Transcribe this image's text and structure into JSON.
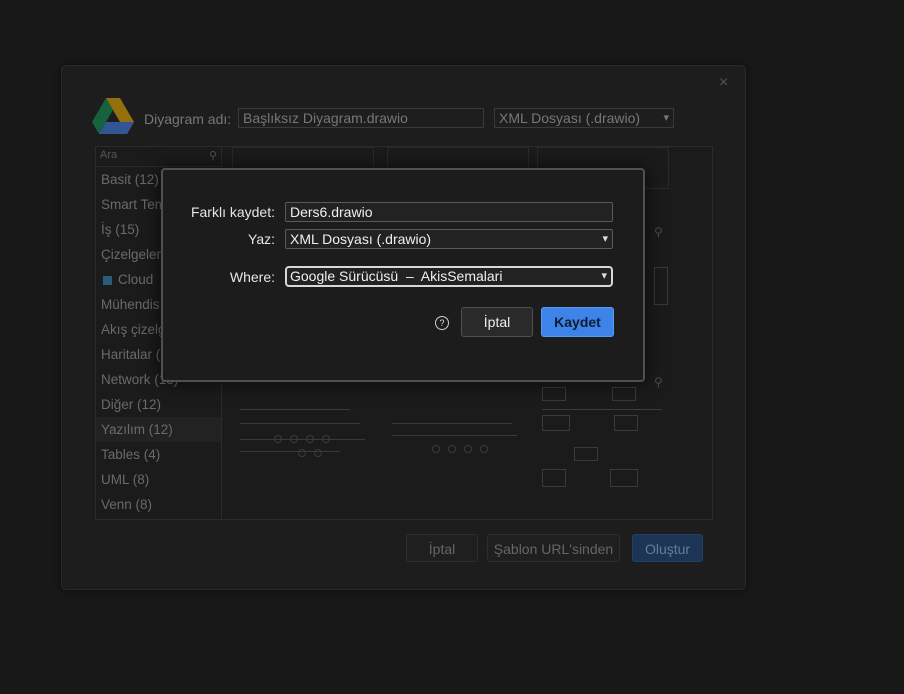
{
  "background_dialog": {
    "close_glyph": "×",
    "name_label": "Diyagram adı:",
    "name_value": "Başlıksız Diyagram.drawio",
    "format_value": "XML Dosyası (.drawio)",
    "search_placeholder": "Ara",
    "categories": [
      "Basit (12)",
      "Smart Tem",
      "İş (15)",
      "Çizelgeler",
      "Cloud",
      "Mühendis",
      "Akış çizelg",
      "Haritalar (",
      "Network (13)",
      "Diğer (12)",
      "Yazılım (12)",
      "Tables (4)",
      "UML (8)",
      "Venn (8)"
    ],
    "selected_category": "Yazılım (12)",
    "buttons": {
      "cancel": "İptal",
      "from_url": "Şablon URL'sinden",
      "create": "Oluştur"
    }
  },
  "save_dialog": {
    "filename_label": "Farklı kaydet:",
    "filename_value": "Ders6.drawio",
    "type_label": "Yaz:",
    "type_value": "XML Dosyası (.drawio)",
    "where_label": "Where:",
    "where_value": "Google Sürücüsü  –  AkisSemalari",
    "help_glyph": "?",
    "cancel_label": "İptal",
    "save_label": "Kaydet"
  },
  "colors": {
    "accent": "#3e83e8",
    "background": "#181818"
  }
}
